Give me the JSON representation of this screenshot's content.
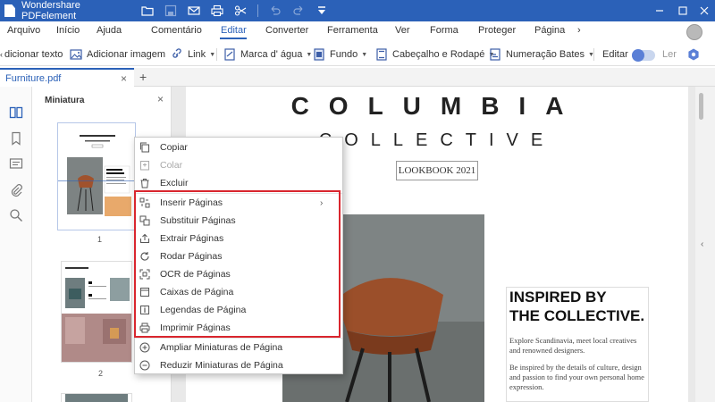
{
  "titlebar": {
    "app_title": "Wondershare PDFelement",
    "tools": [
      "folder-icon",
      "save-icon",
      "mail-icon",
      "print-icon",
      "scissors-icon",
      "undo-icon",
      "redo-icon",
      "quick-access-dropdown-icon"
    ],
    "window_controls": [
      "minimize-icon",
      "maximize-icon",
      "close-icon"
    ]
  },
  "menu": {
    "items": [
      "Arquivo",
      "Início",
      "Ajuda",
      "Comentário",
      "Editar",
      "Converter",
      "Ferramenta",
      "Ver",
      "Forma",
      "Proteger",
      "Página"
    ],
    "active": "Editar",
    "more": "›"
  },
  "toolbar": {
    "add_text": "dicionar texto",
    "add_image": "Adicionar imagem",
    "link": "Link",
    "watermark": "Marca d' água",
    "background": "Fundo",
    "header_footer": "Cabeçalho e Rodapé",
    "bates": "Numeração Bates",
    "edit": "Editar",
    "read": "Ler"
  },
  "tabs": {
    "doc_name": "Furniture.pdf",
    "close": "×",
    "add": "+"
  },
  "sidebar": {
    "rail_icons": [
      "thumbnails-icon",
      "bookmark-icon",
      "comment-icon",
      "attachment-icon",
      "search-icon"
    ]
  },
  "thumbnails": {
    "title": "Miniatura",
    "close": "×",
    "pages": [
      "1",
      "2"
    ]
  },
  "context_menu": {
    "items": [
      {
        "label": "Copiar",
        "icon": "copy-icon",
        "enabled": true
      },
      {
        "label": "Colar",
        "icon": "paste-icon",
        "enabled": false
      },
      {
        "label": "Excluir",
        "icon": "trash-icon",
        "enabled": true
      },
      {
        "label": "Inserir Páginas",
        "icon": "insert-pages-icon",
        "enabled": true,
        "submenu": true
      },
      {
        "label": "Substituir Páginas",
        "icon": "replace-pages-icon",
        "enabled": true
      },
      {
        "label": "Extrair Páginas",
        "icon": "extract-pages-icon",
        "enabled": true
      },
      {
        "label": "Rodar Páginas",
        "icon": "rotate-icon",
        "enabled": true
      },
      {
        "label": "OCR de Páginas",
        "icon": "ocr-icon",
        "enabled": true
      },
      {
        "label": "Caixas de Página",
        "icon": "page-boxes-icon",
        "enabled": true
      },
      {
        "label": "Legendas de Página",
        "icon": "page-labels-icon",
        "enabled": true
      },
      {
        "label": "Imprimir Páginas",
        "icon": "print-icon",
        "enabled": true
      },
      {
        "label": "Ampliar Miniaturas de Página",
        "icon": "zoom-in-icon",
        "enabled": true
      },
      {
        "label": "Reduzir Miniaturas de Página",
        "icon": "zoom-out-icon",
        "enabled": true
      }
    ]
  },
  "document": {
    "title": "COLUMBIA",
    "subtitle": "COLLECTIVE",
    "lookbook": "LOOKBOOK 2021",
    "inspired_line1": "INSPIRED BY",
    "inspired_line2": "THE COLLECTIVE.",
    "explore": "Explore Scandinavia, meet local creatives and renowned designers.",
    "inspire": "Be inspired by the details of culture, design and passion to find your own personal home expression."
  },
  "colors": {
    "brand": "#2b61b8",
    "highlight_border": "#d9262e"
  }
}
